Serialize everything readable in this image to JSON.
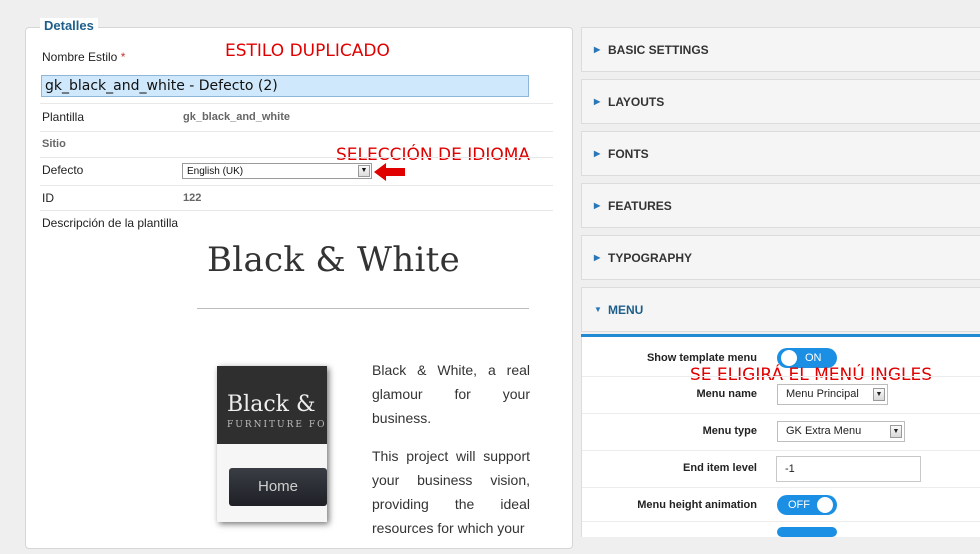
{
  "details": {
    "legend": "Detalles",
    "name_label": "Nombre Estilo",
    "required_mark": "*",
    "name_value": "gk_black_and_white - Defecto (2)",
    "template_label": "Plantilla",
    "template_value": "gk_black_and_white",
    "site_label": "Sitio",
    "default_label": "Defecto",
    "default_select": "English (UK)",
    "id_label": "ID",
    "id_value": "122",
    "desc_label": "Descripción de la plantilla"
  },
  "annotations": {
    "duplicated": "ESTILO DUPLICADO",
    "language": "SELECCIÓN DE IDIOMA",
    "menu": "SE ELIGIRÁ EL MENÚ INGLES"
  },
  "preview": {
    "title": "Black & White",
    "logo": "Black &",
    "subtitle": "FURNITURE FOR",
    "button": "Home",
    "para1": "Black & White, a real glamour for your business.",
    "para2": "This project will support your business vision, providing the ideal resources for which your"
  },
  "accordion": [
    {
      "label": "BASIC SETTINGS",
      "open": false
    },
    {
      "label": "LAYOUTS",
      "open": false
    },
    {
      "label": "FONTS",
      "open": false
    },
    {
      "label": "FEATURES",
      "open": false
    },
    {
      "label": "TYPOGRAPHY",
      "open": false
    },
    {
      "label": "MENU",
      "open": true
    }
  ],
  "menu": {
    "show_menu_label": "Show template menu",
    "show_menu_state": "ON",
    "menu_name_label": "Menu name",
    "menu_name_value": "Menu Principal",
    "menu_type_label": "Menu type",
    "menu_type_value": "GK Extra Menu",
    "end_level_label": "End item level",
    "end_level_value": "-1",
    "height_anim_label": "Menu height animation",
    "height_anim_state": "OFF"
  },
  "colors": {
    "accent": "#1b8fe3",
    "legend": "#1d5f8a",
    "annotation": "#e00000",
    "input_highlight": "#cfe8fb"
  }
}
